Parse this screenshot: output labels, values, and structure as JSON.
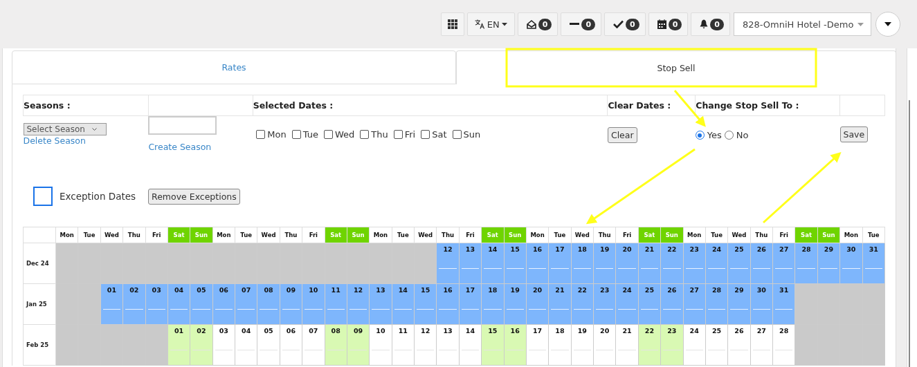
{
  "topbar": {
    "language": {
      "label": "EN"
    },
    "counters": [
      {
        "kind": "inbox",
        "count": "0"
      },
      {
        "kind": "minus",
        "count": "0"
      },
      {
        "kind": "check",
        "count": "0"
      },
      {
        "kind": "calendar",
        "count": "0"
      },
      {
        "kind": "bell",
        "count": "0"
      }
    ],
    "property_select": {
      "value": "828-OmniH Hotel -Demo"
    }
  },
  "tabs": [
    {
      "label": "Rates",
      "selected": false
    },
    {
      "label": "Stop Sell",
      "selected": true
    }
  ],
  "form": {
    "headers": [
      {
        "kind": "text",
        "label": "Seasons :"
      },
      {
        "kind": "blank"
      },
      {
        "kind": "text",
        "label": "Selected Dates :"
      },
      {
        "kind": "text",
        "label": "Clear Dates :"
      },
      {
        "kind": "text",
        "label": "Change Stop Sell To :"
      },
      {
        "kind": "blank"
      }
    ],
    "season_select": {
      "value": "Select Season"
    },
    "delete_season": "Delete Season",
    "create_season": "Create Season",
    "weekdays": [
      {
        "label": "Mon",
        "checked": false
      },
      {
        "label": "Tue",
        "checked": false
      },
      {
        "label": "Wed",
        "checked": false
      },
      {
        "label": "Thu",
        "checked": false
      },
      {
        "label": "Fri",
        "checked": false
      },
      {
        "label": "Sat",
        "checked": false
      },
      {
        "label": "Sun",
        "checked": false
      }
    ],
    "clear_button": "Clear",
    "stop_sell_options": [
      {
        "label": "Yes",
        "selected": true
      },
      {
        "label": "No",
        "selected": false
      }
    ],
    "save_button": "Save"
  },
  "exceptions": {
    "label": "Exception Dates",
    "remove_button": "Remove Exceptions"
  },
  "calendar": {
    "columns": [
      {
        "label": "Mon",
        "weekend": false
      },
      {
        "label": "Tue",
        "weekend": false
      },
      {
        "label": "Wed",
        "weekend": false
      },
      {
        "label": "Thu",
        "weekend": false
      },
      {
        "label": "Fri",
        "weekend": false
      },
      {
        "label": "Sat",
        "weekend": true
      },
      {
        "label": "Sun",
        "weekend": true
      },
      {
        "label": "Mon",
        "weekend": false
      },
      {
        "label": "Tue",
        "weekend": false
      },
      {
        "label": "Wed",
        "weekend": false
      },
      {
        "label": "Thu",
        "weekend": false
      },
      {
        "label": "Fri",
        "weekend": false
      },
      {
        "label": "Sat",
        "weekend": true
      },
      {
        "label": "Sun",
        "weekend": true
      },
      {
        "label": "Mon",
        "weekend": false
      },
      {
        "label": "Tue",
        "weekend": false
      },
      {
        "label": "Wed",
        "weekend": false
      },
      {
        "label": "Thu",
        "weekend": false
      },
      {
        "label": "Fri",
        "weekend": false
      },
      {
        "label": "Sat",
        "weekend": true
      },
      {
        "label": "Sun",
        "weekend": true
      },
      {
        "label": "Mon",
        "weekend": false
      },
      {
        "label": "Tue",
        "weekend": false
      },
      {
        "label": "Wed",
        "weekend": false
      },
      {
        "label": "Thu",
        "weekend": false
      },
      {
        "label": "Fri",
        "weekend": false
      },
      {
        "label": "Sat",
        "weekend": true
      },
      {
        "label": "Sun",
        "weekend": true
      },
      {
        "label": "Mon",
        "weekend": false
      },
      {
        "label": "Tue",
        "weekend": false
      },
      {
        "label": "Wed",
        "weekend": false
      },
      {
        "label": "Thu",
        "weekend": false
      },
      {
        "label": "Fri",
        "weekend": false
      },
      {
        "label": "Sat",
        "weekend": true
      },
      {
        "label": "Sun",
        "weekend": true
      },
      {
        "label": "Mon",
        "weekend": false
      },
      {
        "label": "Tue",
        "weekend": false
      }
    ],
    "rows": [
      {
        "label": "Dec 24",
        "cells": [
          {
            "kind": "blank"
          },
          {
            "kind": "blank"
          },
          {
            "kind": "blank"
          },
          {
            "kind": "blank"
          },
          {
            "kind": "blank"
          },
          {
            "kind": "blank"
          },
          {
            "kind": "blank"
          },
          {
            "kind": "blank"
          },
          {
            "kind": "blank"
          },
          {
            "kind": "blank"
          },
          {
            "kind": "blank"
          },
          {
            "kind": "blank"
          },
          {
            "kind": "blank"
          },
          {
            "kind": "blank"
          },
          {
            "kind": "blank"
          },
          {
            "kind": "blank"
          },
          {
            "kind": "blank"
          },
          {
            "kind": "day",
            "day": "12",
            "stop_sell": true
          },
          {
            "kind": "day",
            "day": "13",
            "stop_sell": true
          },
          {
            "kind": "day",
            "day": "14",
            "stop_sell": true
          },
          {
            "kind": "day",
            "day": "15",
            "stop_sell": true
          },
          {
            "kind": "day",
            "day": "16",
            "stop_sell": true
          },
          {
            "kind": "day",
            "day": "17",
            "stop_sell": true
          },
          {
            "kind": "day",
            "day": "18",
            "stop_sell": true
          },
          {
            "kind": "day",
            "day": "19",
            "stop_sell": true
          },
          {
            "kind": "day",
            "day": "20",
            "stop_sell": true
          },
          {
            "kind": "day",
            "day": "21",
            "stop_sell": true
          },
          {
            "kind": "day",
            "day": "22",
            "stop_sell": true
          },
          {
            "kind": "day",
            "day": "23",
            "stop_sell": true
          },
          {
            "kind": "day",
            "day": "24",
            "stop_sell": true
          },
          {
            "kind": "day",
            "day": "25",
            "stop_sell": true
          },
          {
            "kind": "day",
            "day": "26",
            "stop_sell": true
          },
          {
            "kind": "day",
            "day": "27",
            "stop_sell": true
          },
          {
            "kind": "day",
            "day": "28",
            "stop_sell": true
          },
          {
            "kind": "day",
            "day": "29",
            "stop_sell": true
          },
          {
            "kind": "day",
            "day": "30",
            "stop_sell": true
          },
          {
            "kind": "day",
            "day": "31",
            "stop_sell": true
          }
        ]
      },
      {
        "label": "Jan 25",
        "cells": [
          {
            "kind": "blank"
          },
          {
            "kind": "blank"
          },
          {
            "kind": "day",
            "day": "01",
            "stop_sell": true
          },
          {
            "kind": "day",
            "day": "02",
            "stop_sell": true
          },
          {
            "kind": "day",
            "day": "03",
            "stop_sell": true
          },
          {
            "kind": "day",
            "day": "04",
            "stop_sell": true
          },
          {
            "kind": "day",
            "day": "05",
            "stop_sell": true
          },
          {
            "kind": "day",
            "day": "06",
            "stop_sell": true
          },
          {
            "kind": "day",
            "day": "07",
            "stop_sell": true
          },
          {
            "kind": "day",
            "day": "08",
            "stop_sell": true
          },
          {
            "kind": "day",
            "day": "09",
            "stop_sell": true
          },
          {
            "kind": "day",
            "day": "10",
            "stop_sell": true
          },
          {
            "kind": "day",
            "day": "11",
            "stop_sell": true
          },
          {
            "kind": "day",
            "day": "12",
            "stop_sell": true
          },
          {
            "kind": "day",
            "day": "13",
            "stop_sell": true
          },
          {
            "kind": "day",
            "day": "14",
            "stop_sell": true
          },
          {
            "kind": "day",
            "day": "15",
            "stop_sell": true
          },
          {
            "kind": "day",
            "day": "16",
            "stop_sell": true
          },
          {
            "kind": "day",
            "day": "17",
            "stop_sell": true
          },
          {
            "kind": "day",
            "day": "18",
            "stop_sell": true
          },
          {
            "kind": "day",
            "day": "19",
            "stop_sell": true
          },
          {
            "kind": "day",
            "day": "20",
            "stop_sell": true
          },
          {
            "kind": "day",
            "day": "21",
            "stop_sell": true
          },
          {
            "kind": "day",
            "day": "22",
            "stop_sell": true
          },
          {
            "kind": "day",
            "day": "23",
            "stop_sell": true
          },
          {
            "kind": "day",
            "day": "24",
            "stop_sell": true
          },
          {
            "kind": "day",
            "day": "25",
            "stop_sell": true
          },
          {
            "kind": "day",
            "day": "26",
            "stop_sell": true
          },
          {
            "kind": "day",
            "day": "27",
            "stop_sell": true
          },
          {
            "kind": "day",
            "day": "28",
            "stop_sell": true
          },
          {
            "kind": "day",
            "day": "29",
            "stop_sell": true
          },
          {
            "kind": "day",
            "day": "30",
            "stop_sell": true
          },
          {
            "kind": "day",
            "day": "31",
            "stop_sell": true
          },
          {
            "kind": "blank"
          },
          {
            "kind": "blank"
          },
          {
            "kind": "blank"
          },
          {
            "kind": "blank"
          }
        ]
      },
      {
        "label": "Feb 25",
        "cells": [
          {
            "kind": "blank"
          },
          {
            "kind": "blank"
          },
          {
            "kind": "blank"
          },
          {
            "kind": "blank"
          },
          {
            "kind": "blank"
          },
          {
            "kind": "day",
            "day": "01",
            "stop_sell": false
          },
          {
            "kind": "day",
            "day": "02",
            "stop_sell": false
          },
          {
            "kind": "day",
            "day": "03",
            "stop_sell": false
          },
          {
            "kind": "day",
            "day": "04",
            "stop_sell": false
          },
          {
            "kind": "day",
            "day": "05",
            "stop_sell": false
          },
          {
            "kind": "day",
            "day": "06",
            "stop_sell": false
          },
          {
            "kind": "day",
            "day": "07",
            "stop_sell": false
          },
          {
            "kind": "day",
            "day": "08",
            "stop_sell": false
          },
          {
            "kind": "day",
            "day": "09",
            "stop_sell": false
          },
          {
            "kind": "day",
            "day": "10",
            "stop_sell": false
          },
          {
            "kind": "day",
            "day": "11",
            "stop_sell": false
          },
          {
            "kind": "day",
            "day": "12",
            "stop_sell": false
          },
          {
            "kind": "day",
            "day": "13",
            "stop_sell": false
          },
          {
            "kind": "day",
            "day": "14",
            "stop_sell": false
          },
          {
            "kind": "day",
            "day": "15",
            "stop_sell": false
          },
          {
            "kind": "day",
            "day": "16",
            "stop_sell": false
          },
          {
            "kind": "day",
            "day": "17",
            "stop_sell": false
          },
          {
            "kind": "day",
            "day": "18",
            "stop_sell": false
          },
          {
            "kind": "day",
            "day": "19",
            "stop_sell": false
          },
          {
            "kind": "day",
            "day": "20",
            "stop_sell": false
          },
          {
            "kind": "day",
            "day": "21",
            "stop_sell": false
          },
          {
            "kind": "day",
            "day": "22",
            "stop_sell": false
          },
          {
            "kind": "day",
            "day": "23",
            "stop_sell": false
          },
          {
            "kind": "day",
            "day": "24",
            "stop_sell": false
          },
          {
            "kind": "day",
            "day": "25",
            "stop_sell": false
          },
          {
            "kind": "day",
            "day": "26",
            "stop_sell": false
          },
          {
            "kind": "day",
            "day": "27",
            "stop_sell": false
          },
          {
            "kind": "day",
            "day": "28",
            "stop_sell": false
          },
          {
            "kind": "blank"
          },
          {
            "kind": "blank"
          },
          {
            "kind": "blank"
          },
          {
            "kind": "blank"
          }
        ]
      }
    ]
  }
}
